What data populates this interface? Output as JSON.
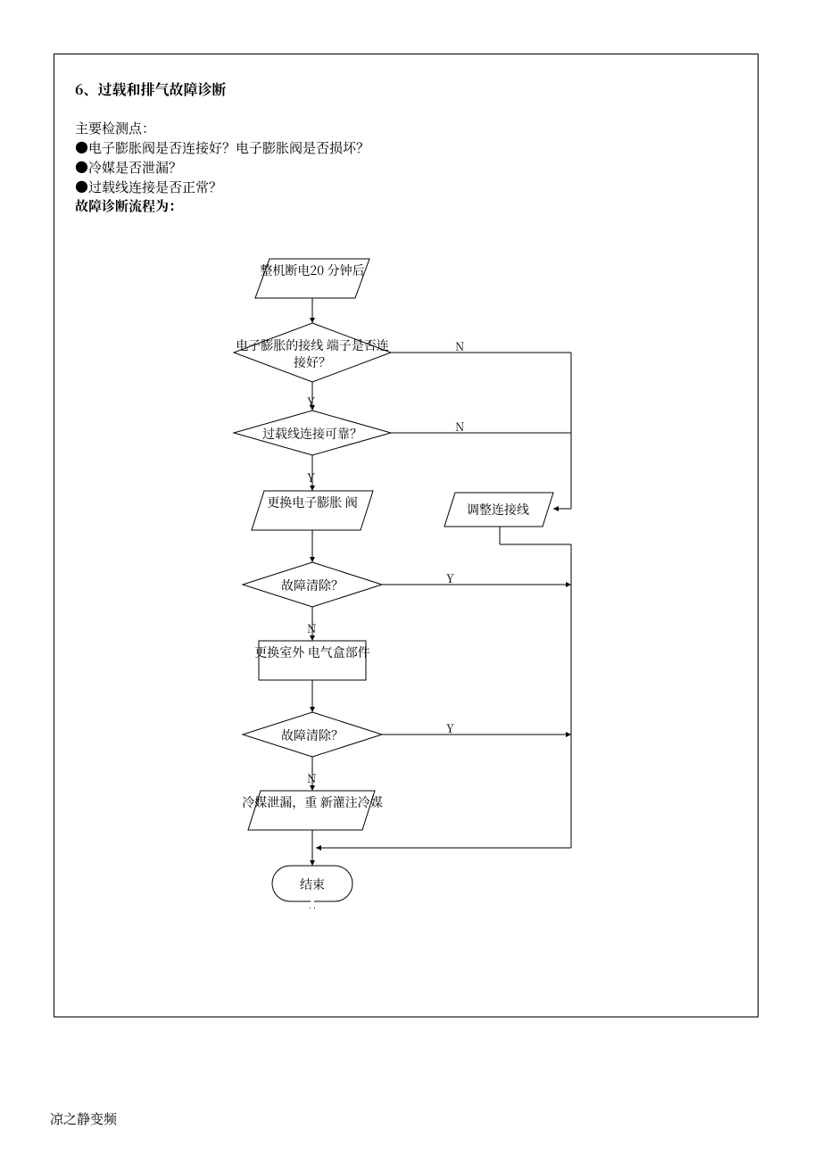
{
  "title": "6、过载和排气故障诊断",
  "intro_label": "主要检测点：",
  "bullets": [
    "●电子膨胀阀是否连接好？电子膨胀阀是否损坏？",
    "●冷媒是否泄漏？",
    "●过载线连接是否正常？"
  ],
  "flow_heading": "故障诊断流程为：",
  "nodes": {
    "start": "整机断电20\n分钟后",
    "d1": "电子膨胀的接线\n端子是否连接好？",
    "d2": "过载线连接可靠？",
    "p1": "更换电子膨胀\n阀",
    "side": "调整连接线",
    "d3": "故障清除？",
    "r1": "更换室外\n电气盒部件",
    "d4": "故障清除？",
    "p2": "冷媒泄漏，重\n新灌注冷媒",
    "end": "结束"
  },
  "labels": {
    "yes": "Y",
    "no": "N"
  },
  "footer": "凉之静变频"
}
